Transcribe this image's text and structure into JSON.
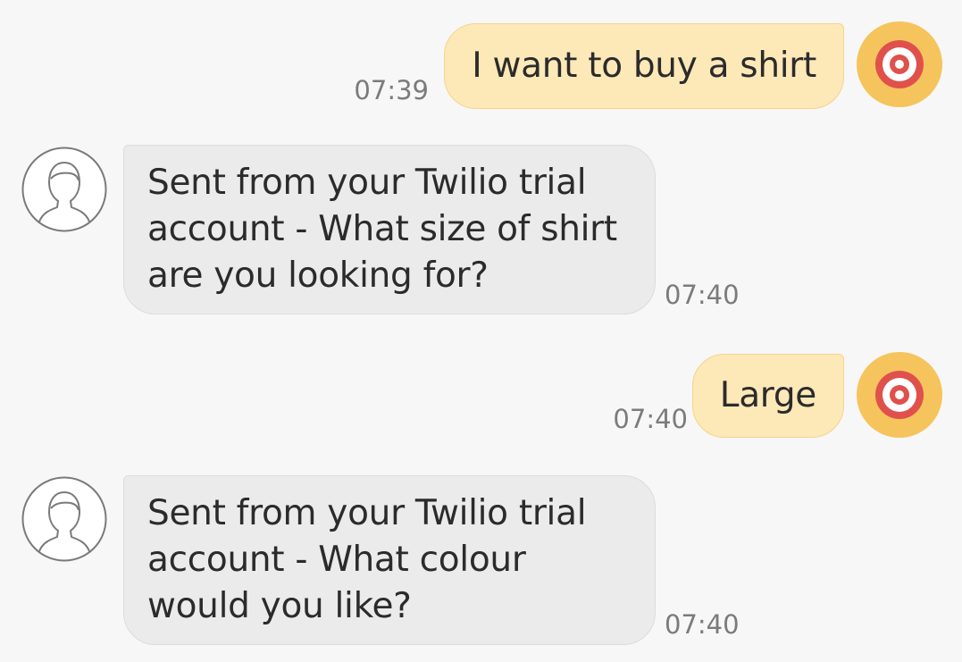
{
  "conversation": {
    "messages": [
      {
        "direction": "outgoing",
        "text": "I want to buy a shirt",
        "time": "07:39",
        "avatar_icon": "target-icon"
      },
      {
        "direction": "incoming",
        "text": "Sent from your Twilio trial account - What size of shirt are you looking for?",
        "time": "07:40",
        "avatar_icon": "person-outline-icon"
      },
      {
        "direction": "outgoing",
        "text": "Large",
        "time": "07:40",
        "avatar_icon": "target-icon"
      },
      {
        "direction": "incoming",
        "text": "Sent from your Twilio trial account - What colour would you like?",
        "time": "07:40",
        "avatar_icon": "person-outline-icon"
      }
    ]
  },
  "colors": {
    "outgoing_bubble": "#fde8b8",
    "incoming_bubble": "#ebebeb",
    "background": "#f7f7f7",
    "target_ring_outer": "#f6c45c",
    "target_ring_red": "#e0504c",
    "timestamp": "#7b7b7b"
  }
}
